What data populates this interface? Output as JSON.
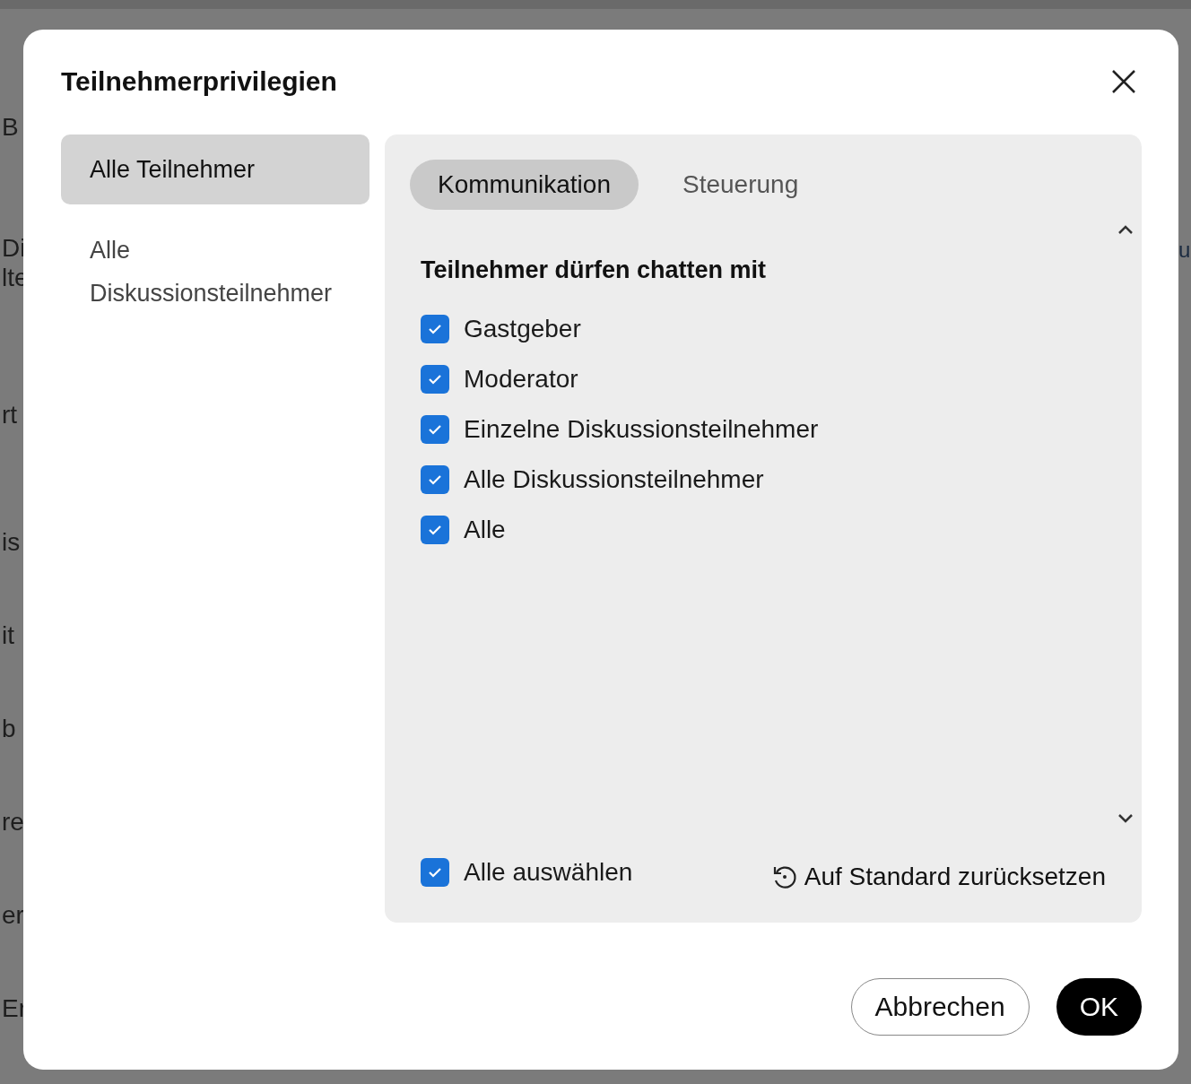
{
  "background": {
    "left_fragments": [
      "B",
      "Di\nlte",
      "rt",
      "is",
      "it",
      "b",
      "re",
      "er",
      "Er"
    ],
    "right_fragments": [
      "u"
    ]
  },
  "dialog": {
    "title": "Teilnehmerprivilegien",
    "nav": [
      {
        "label": "Alle Teilnehmer",
        "selected": true
      },
      {
        "label": "Alle Diskussionsteilnehmer",
        "selected": false
      }
    ],
    "tabs": [
      {
        "label": "Kommunikation",
        "selected": true
      },
      {
        "label": "Steuerung",
        "selected": false
      }
    ],
    "section_heading": "Teilnehmer dürfen chatten mit",
    "options": [
      {
        "label": "Gastgeber",
        "checked": true
      },
      {
        "label": "Moderator",
        "checked": true
      },
      {
        "label": "Einzelne Diskussionsteilnehmer",
        "checked": true
      },
      {
        "label": "Alle Diskussionsteilnehmer",
        "checked": true
      },
      {
        "label": "Alle",
        "checked": true
      }
    ],
    "select_all": {
      "label": "Alle auswählen",
      "checked": true
    },
    "reset_link": "Auf Standard zurücksetzen",
    "buttons": [
      {
        "label": "Abbrechen",
        "kind": "secondary"
      },
      {
        "label": "OK",
        "kind": "primary"
      }
    ]
  }
}
